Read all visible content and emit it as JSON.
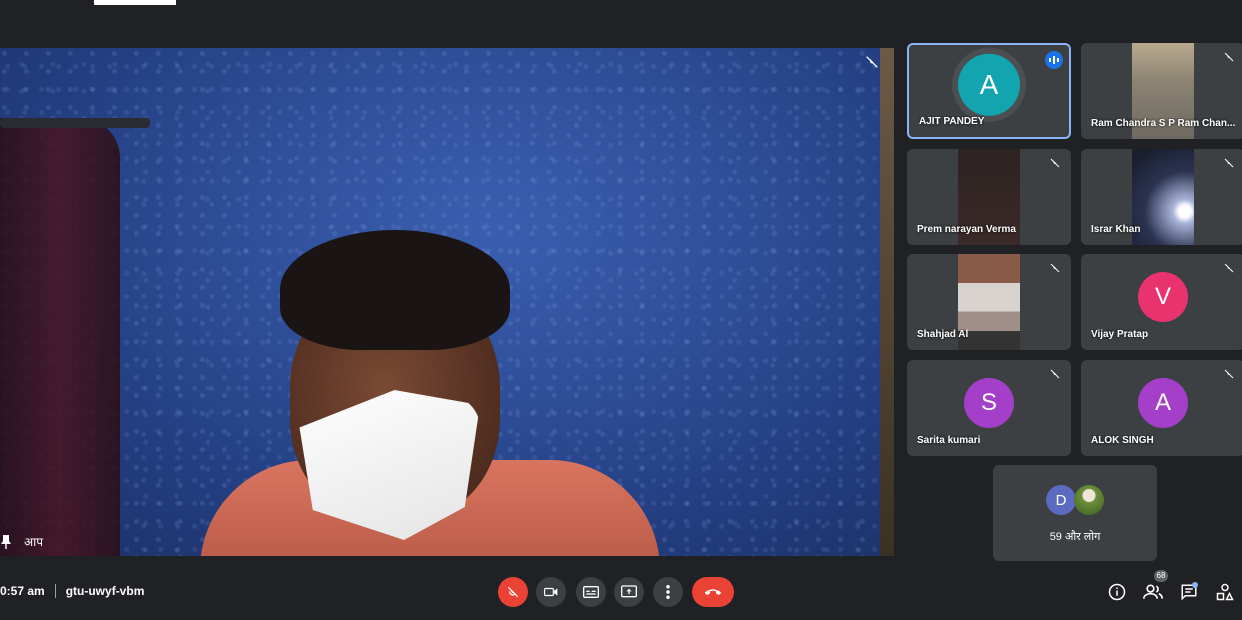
{
  "main": {
    "self_label": "आप"
  },
  "tiles": [
    {
      "name": "AJIT PANDEY",
      "avatar_letter": "A",
      "avatar_color": "#12a4af",
      "speaking": true
    },
    {
      "name": "Ram Chandra S P Ram Chan...",
      "camera": true
    },
    {
      "name": "Prem narayan Verma",
      "camera": true
    },
    {
      "name": "Israr Khan",
      "camera": true
    },
    {
      "name": "Shahjad Al",
      "camera": true
    },
    {
      "name": "Vijay Pratap",
      "avatar_letter": "V",
      "avatar_color": "#e8336e"
    },
    {
      "name": "Sarita kumari",
      "avatar_letter": "S",
      "avatar_color": "#a33fc8"
    },
    {
      "name": "ALOK SINGH",
      "avatar_letter": "A",
      "avatar_color": "#a33fc8"
    }
  ],
  "more": {
    "avatar_letter": "D",
    "avatar_color": "#5c6bc0",
    "label": "59 और लोग"
  },
  "bottom": {
    "time": "0:57 am",
    "meeting_code": "gtu-uwyf-vbm",
    "participants_count": "68"
  },
  "colors": {
    "accent": "#8ab4f8",
    "danger": "#ea4335",
    "tile_bg": "#3c4043",
    "bg": "#202124"
  }
}
